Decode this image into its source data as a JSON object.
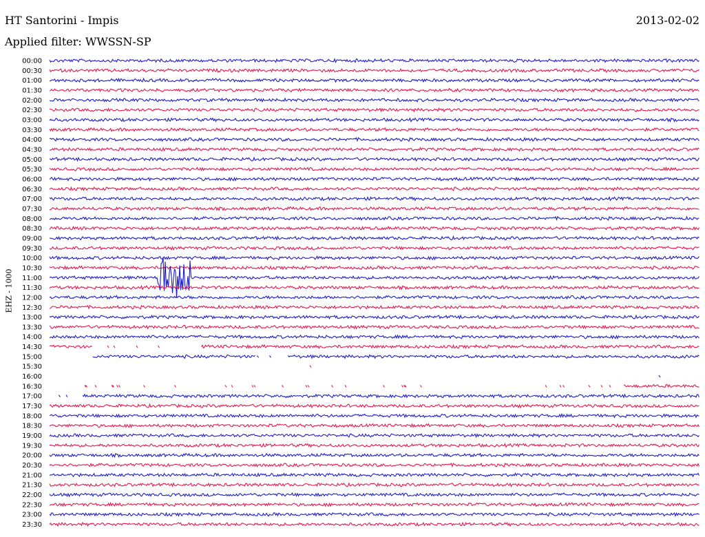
{
  "header": {
    "title": "HT Santorini - Impis",
    "filter": "Applied filter: WWSSN-SP",
    "date": "2013-02-02"
  },
  "chart_data": {
    "type": "line",
    "title": "HT Santorini - Impis",
    "subtitle": "Applied filter: WWSSN-SP",
    "date": "2013-02-02",
    "ylabel": "EHZ - 1000",
    "row_labels": [
      "00:00",
      "00:30",
      "01:00",
      "01:30",
      "02:00",
      "02:30",
      "03:00",
      "03:30",
      "04:00",
      "04:30",
      "05:00",
      "05:30",
      "06:00",
      "06:30",
      "07:00",
      "07:30",
      "08:00",
      "08:30",
      "09:00",
      "09:30",
      "10:00",
      "10:30",
      "11:00",
      "11:30",
      "12:00",
      "12:30",
      "13:00",
      "13:30",
      "14:00",
      "14:30",
      "15:00",
      "15:30",
      "16:00",
      "16:30",
      "17:00",
      "17:30",
      "18:00",
      "18:30",
      "19:00",
      "19:30",
      "20:00",
      "20:30",
      "21:00",
      "21:30",
      "22:00",
      "22:30",
      "23:00",
      "23:30"
    ],
    "colors": [
      "#1a1acc",
      "#e8144a"
    ],
    "row_minutes": 30,
    "events": [
      {
        "row": "11:00",
        "minute_start": 5,
        "minute_end": 6.5,
        "description": "large seismic signal"
      }
    ],
    "gaps": [
      {
        "row": "14:30",
        "minute_from": 2,
        "minute_to": 7
      },
      {
        "row": "15:00",
        "minute_from": 0,
        "minute_to": 2
      },
      {
        "row": "15:00",
        "minute_from": 9.5,
        "minute_to": 11
      },
      {
        "row": "15:30",
        "minute_from": 0,
        "minute_to": 30
      },
      {
        "row": "16:00",
        "minute_from": 0,
        "minute_to": 30
      },
      {
        "row": "16:30",
        "minute_from": 0,
        "minute_to": 26.5
      },
      {
        "row": "17:00",
        "minute_from": 0,
        "minute_to": 1.5
      }
    ]
  }
}
